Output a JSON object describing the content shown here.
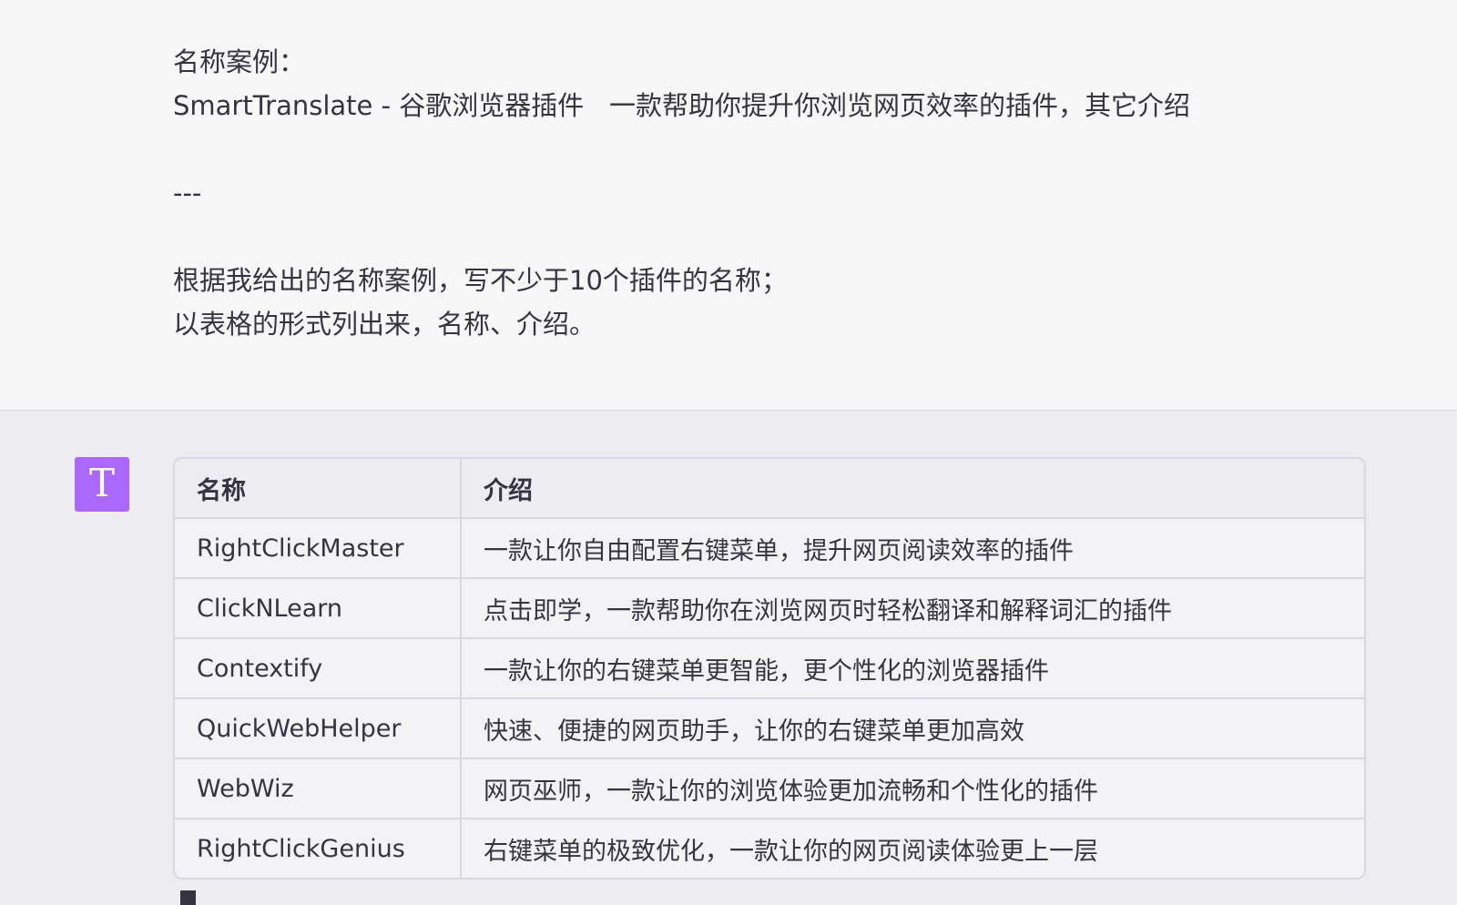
{
  "user_message": {
    "line1": "名称案例：",
    "line2": "SmartTranslate - 谷歌浏览器插件   一款帮助你提升你浏览网页效率的插件，其它介绍",
    "separator": "---",
    "line3": "根据我给出的名称案例，写不少于10个插件的名称；",
    "line4": "以表格的形式列出来，名称、介绍。"
  },
  "assistant": {
    "avatar_letter": "T",
    "avatar_color": "#ab68ff",
    "table": {
      "headers": [
        "名称",
        "介绍"
      ],
      "rows": [
        {
          "name": "RightClickMaster",
          "desc": "一款让你自由配置右键菜单，提升网页阅读效率的插件"
        },
        {
          "name": "ClickNLearn",
          "desc": "点击即学，一款帮助你在浏览网页时轻松翻译和解释词汇的插件"
        },
        {
          "name": "Contextify",
          "desc": "一款让你的右键菜单更智能，更个性化的浏览器插件"
        },
        {
          "name": "QuickWebHelper",
          "desc": "快速、便捷的网页助手，让你的右键菜单更加高效"
        },
        {
          "name": "WebWiz",
          "desc": "网页巫师，一款让你的浏览体验更加流畅和个性化的插件"
        },
        {
          "name": "RightClickGenius",
          "desc": "右键菜单的极致优化，一款让你的网页阅读体验更上一层"
        }
      ]
    }
  }
}
